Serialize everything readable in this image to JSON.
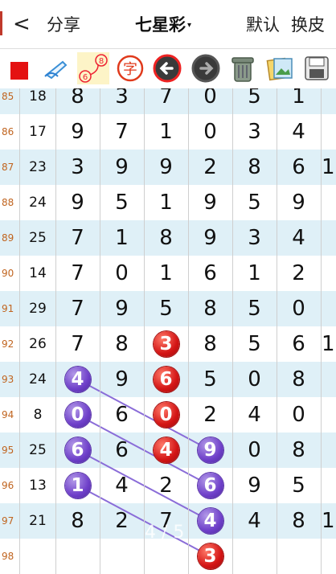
{
  "topbar": {
    "back_glyph": "<",
    "share_label": "分享",
    "title": "七星彩",
    "title_caret": "▾",
    "mode_label": "默认",
    "skin_label": "换皮"
  },
  "toolbar": [
    {
      "name": "red-square-icon"
    },
    {
      "name": "eraser-pen-icon"
    },
    {
      "name": "connect-line-icon",
      "badge_top": "8",
      "badge_bottom": "6"
    },
    {
      "name": "character-stamp-icon",
      "glyph": "字"
    },
    {
      "name": "undo-arrow-icon"
    },
    {
      "name": "redo-arrow-icon"
    },
    {
      "name": "trash-can-icon"
    },
    {
      "name": "photos-icon"
    },
    {
      "name": "save-disk-icon"
    }
  ],
  "rows": [
    {
      "issue": "85",
      "sum": "18",
      "digits": [
        "8",
        "3",
        "7",
        "0",
        "5",
        "1"
      ]
    },
    {
      "issue": "86",
      "sum": "17",
      "digits": [
        "9",
        "7",
        "1",
        "0",
        "3",
        "4"
      ]
    },
    {
      "issue": "87",
      "sum": "23",
      "digits": [
        "3",
        "9",
        "9",
        "2",
        "8",
        "6"
      ],
      "extra": "1"
    },
    {
      "issue": "88",
      "sum": "24",
      "digits": [
        "9",
        "5",
        "1",
        "9",
        "5",
        "9"
      ]
    },
    {
      "issue": "89",
      "sum": "25",
      "digits": [
        "7",
        "1",
        "8",
        "9",
        "3",
        "4"
      ]
    },
    {
      "issue": "90",
      "sum": "14",
      "digits": [
        "7",
        "0",
        "1",
        "6",
        "1",
        "2"
      ]
    },
    {
      "issue": "91",
      "sum": "29",
      "digits": [
        "7",
        "9",
        "5",
        "8",
        "5",
        "0"
      ]
    },
    {
      "issue": "92",
      "sum": "26",
      "digits": [
        "7",
        "8",
        "3",
        "8",
        "5",
        "6"
      ],
      "extra": "1"
    },
    {
      "issue": "93",
      "sum": "24",
      "digits": [
        "4",
        "9",
        "6",
        "5",
        "0",
        "8"
      ]
    },
    {
      "issue": "94",
      "sum": "8",
      "digits": [
        "0",
        "6",
        "0",
        "2",
        "4",
        "0"
      ]
    },
    {
      "issue": "95",
      "sum": "25",
      "digits": [
        "6",
        "6",
        "4",
        "9",
        "0",
        "8"
      ]
    },
    {
      "issue": "96",
      "sum": "13",
      "digits": [
        "1",
        "4",
        "2",
        "6",
        "9",
        "5"
      ]
    },
    {
      "issue": "97",
      "sum": "21",
      "digits": [
        "8",
        "2",
        "7",
        "4",
        "4",
        "8"
      ],
      "extra": "1"
    },
    {
      "issue": "98",
      "sum": "",
      "digits": [
        "",
        "",
        "",
        "",
        "",
        ""
      ]
    }
  ],
  "balls": [
    {
      "row": 7,
      "col": 2,
      "color": "red",
      "value": "3"
    },
    {
      "row": 8,
      "col": 0,
      "color": "purple",
      "value": "4"
    },
    {
      "row": 8,
      "col": 2,
      "color": "red",
      "value": "6"
    },
    {
      "row": 9,
      "col": 0,
      "color": "purple",
      "value": "0"
    },
    {
      "row": 9,
      "col": 2,
      "color": "red",
      "value": "0"
    },
    {
      "row": 10,
      "col": 0,
      "color": "purple",
      "value": "6"
    },
    {
      "row": 10,
      "col": 2,
      "color": "red",
      "value": "4"
    },
    {
      "row": 10,
      "col": 3,
      "color": "purple",
      "value": "9"
    },
    {
      "row": 11,
      "col": 0,
      "color": "purple",
      "value": "1"
    },
    {
      "row": 11,
      "col": 3,
      "color": "purple",
      "value": "6"
    },
    {
      "row": 12,
      "col": 3,
      "color": "purple",
      "value": "4"
    },
    {
      "row": 13,
      "col": 3,
      "color": "red",
      "value": "3"
    }
  ],
  "lines": [
    {
      "from": [
        8,
        0
      ],
      "to": [
        10,
        3
      ]
    },
    {
      "from": [
        9,
        0
      ],
      "to": [
        11,
        3
      ]
    },
    {
      "from": [
        10,
        0
      ],
      "to": [
        12,
        3
      ]
    },
    {
      "from": [
        11,
        0
      ],
      "to": [
        13,
        3
      ]
    }
  ],
  "page_hint": "4 / 5",
  "colors": {
    "alt_row": "#dff0f7",
    "issue_text": "#c0641f",
    "separator": "#c06b3a",
    "ball_red": "#d31414",
    "ball_purple": "#6e3fc9"
  }
}
